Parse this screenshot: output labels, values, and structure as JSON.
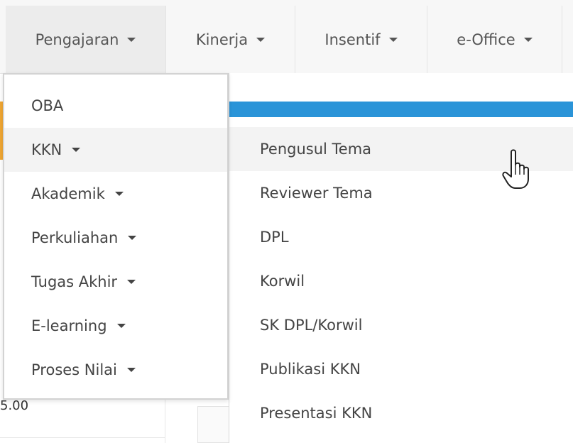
{
  "nav": {
    "items": [
      {
        "label": "Pengajaran",
        "active": true
      },
      {
        "label": "Kinerja",
        "active": false
      },
      {
        "label": "Insentif",
        "active": false
      },
      {
        "label": "e-Office",
        "active": false
      }
    ]
  },
  "dropdown": {
    "items": [
      {
        "label": "OBA",
        "has_submenu": false
      },
      {
        "label": "KKN",
        "has_submenu": true
      },
      {
        "label": "Akademik",
        "has_submenu": true
      },
      {
        "label": "Perkuliahan",
        "has_submenu": true
      },
      {
        "label": "Tugas Akhir",
        "has_submenu": true
      },
      {
        "label": "E-learning",
        "has_submenu": true
      },
      {
        "label": "Proses Nilai",
        "has_submenu": true
      }
    ]
  },
  "submenu": {
    "items": [
      {
        "label": "Pengusul Tema"
      },
      {
        "label": "Reviewer Tema"
      },
      {
        "label": "DPL"
      },
      {
        "label": "Korwil"
      },
      {
        "label": "SK DPL/Korwil"
      },
      {
        "label": "Publikasi KKN"
      },
      {
        "label": "Presentasi KKN"
      }
    ]
  },
  "background": {
    "amount_fragment": "5.00"
  },
  "colors": {
    "accent_blue": "#2a94d8",
    "accent_orange": "#f0a733",
    "hover_bg": "#f3f3f3"
  }
}
